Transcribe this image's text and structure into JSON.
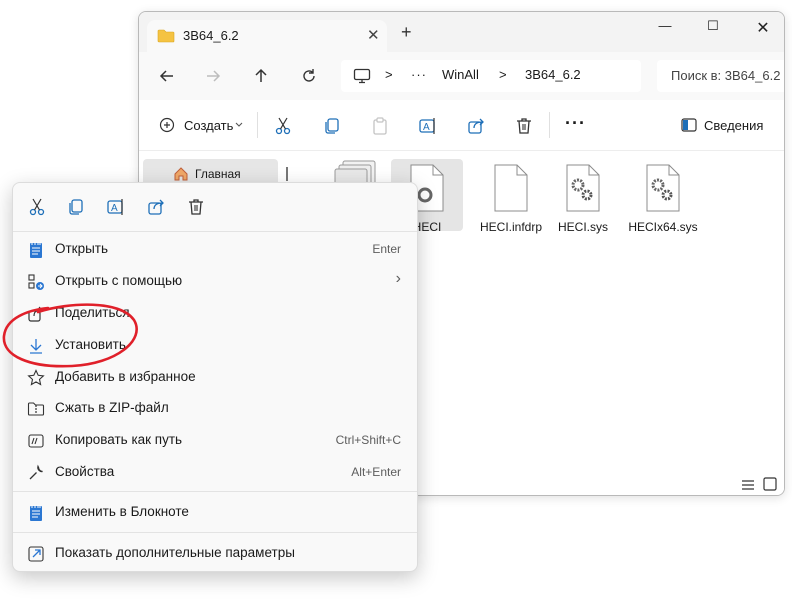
{
  "window": {
    "tab_title": "3B64_6.2",
    "new_tab": "+",
    "controls": {
      "minimize": "—",
      "maximize": "☐",
      "close": "✕"
    }
  },
  "address": {
    "more": "···",
    "segments": [
      "WinAll",
      "3B64_6.2"
    ],
    "separator": ">"
  },
  "search": {
    "placeholder": "Поиск в: 3B64_6.2"
  },
  "toolbar": {
    "create_label": "Создать",
    "more": "···",
    "details_label": "Сведения"
  },
  "sidebar": {
    "home_label": "Главная"
  },
  "files": [
    {
      "name": "HECI",
      "selected": true
    },
    {
      "name": "HECI.infdrp"
    },
    {
      "name": "HECI.sys"
    },
    {
      "name": "HECIx64.sys"
    }
  ],
  "context_menu": {
    "items": [
      {
        "label": "Открыть",
        "shortcut": "Enter",
        "icon": "notepad-icon"
      },
      {
        "label": "Открыть с помощью",
        "shortcut": "›",
        "icon": "open-with-icon"
      },
      {
        "label": "Поделиться",
        "shortcut": "",
        "icon": "share-icon"
      },
      {
        "label": "Установить",
        "shortcut": "",
        "icon": "install-icon"
      },
      {
        "label": "Добавить в избранное",
        "shortcut": "",
        "icon": "star-icon"
      },
      {
        "label": "Сжать в ZIP-файл",
        "shortcut": "",
        "icon": "zip-icon"
      },
      {
        "label": "Копировать как путь",
        "shortcut": "Ctrl+Shift+C",
        "icon": "copy-path-icon"
      },
      {
        "label": "Свойства",
        "shortcut": "Alt+Enter",
        "icon": "wrench-icon"
      },
      {
        "label": "Изменить в Блокноте",
        "shortcut": "",
        "icon": "notepad-icon"
      },
      {
        "label": "Показать дополнительные параметры",
        "shortcut": "",
        "icon": "more-options-icon"
      }
    ]
  },
  "colors": {
    "accent": "#005fb8",
    "annotation": "#e0202a",
    "folder": "#f5c342"
  }
}
